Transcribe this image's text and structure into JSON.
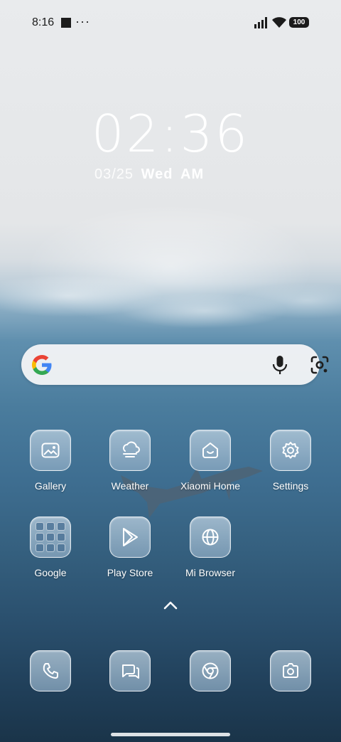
{
  "status_bar": {
    "time": "8:16",
    "overflow": "···",
    "battery": "100"
  },
  "lock_clock": {
    "time": "02:36",
    "date": "03/25",
    "weekday": "Wed",
    "ampm": "AM"
  },
  "search": {
    "google_icon": "google-g-icon",
    "mic_icon": "microphone-icon",
    "lens_icon": "camera-lens-icon"
  },
  "apps_row1": [
    {
      "label": "Gallery",
      "icon": "gallery-icon"
    },
    {
      "label": "Weather",
      "icon": "weather-icon"
    },
    {
      "label": "Xiaomi Home",
      "icon": "xiaomi-home-icon"
    },
    {
      "label": "Settings",
      "icon": "gear-icon"
    }
  ],
  "apps_row2": [
    {
      "label": "Google",
      "icon": "folder-icon"
    },
    {
      "label": "Play Store",
      "icon": "play-store-icon"
    },
    {
      "label": "Mi Browser",
      "icon": "globe-icon"
    }
  ],
  "dock": [
    {
      "icon": "phone-icon"
    },
    {
      "icon": "messages-icon"
    },
    {
      "icon": "chrome-icon"
    },
    {
      "icon": "camera-icon"
    }
  ]
}
